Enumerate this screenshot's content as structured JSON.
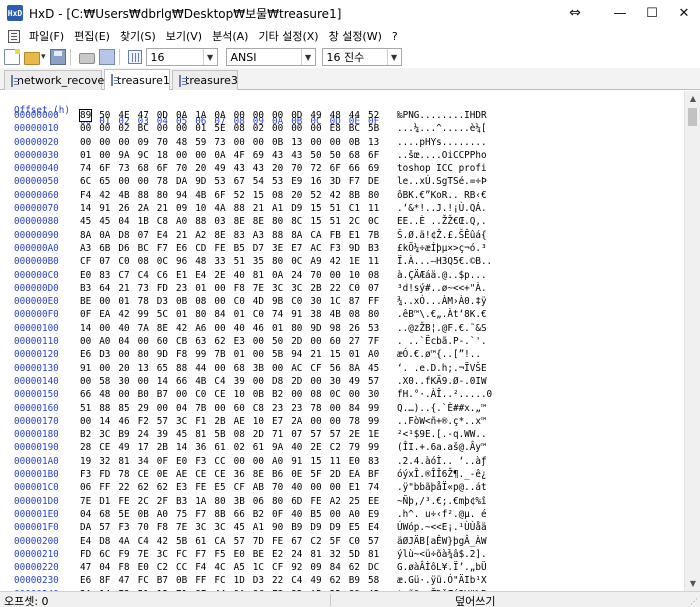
{
  "window": {
    "app_icon_text": "HxD",
    "title": "HxD - [C:₩Users₩dbrlg₩Desktop₩보물₩treasure1]",
    "pin_glyph": "⇔",
    "minimize_glyph": "—",
    "maximize_glyph": "☐",
    "close_glyph": "✕"
  },
  "menu": {
    "items": [
      "파일(F)",
      "편집(E)",
      "찾기(S)",
      "보기(V)",
      "분석(A)",
      "기타 설정(X)",
      "창 설정(W)",
      "?"
    ]
  },
  "toolbar": {
    "bytes_per_row": "16",
    "charset": "ANSI",
    "offset_base": "16 진수"
  },
  "tabs": [
    "network_recover",
    "treasure1",
    "treasure3"
  ],
  "active_tab": "treasure1",
  "editor": {
    "offset_header": "Offset (h)",
    "column_headers": [
      "00",
      "01",
      "02",
      "03",
      "04",
      "05",
      "06",
      "07",
      "08",
      "09",
      "0A",
      "0B",
      "0C",
      "0D",
      "0E",
      "0F"
    ],
    "rows": [
      {
        "offset": "00000000",
        "bytes": [
          "89",
          "50",
          "4E",
          "47",
          "0D",
          "0A",
          "1A",
          "0A",
          "00",
          "00",
          "00",
          "0D",
          "49",
          "48",
          "44",
          "52"
        ],
        "text": "‰PNG........IHDR"
      },
      {
        "offset": "00000010",
        "bytes": [
          "00",
          "00",
          "02",
          "BC",
          "00",
          "00",
          "01",
          "5E",
          "08",
          "02",
          "00",
          "00",
          "00",
          "E8",
          "BC",
          "5B"
        ],
        "text": "...¼...^.....è¼["
      },
      {
        "offset": "00000020",
        "bytes": [
          "00",
          "00",
          "00",
          "09",
          "70",
          "48",
          "59",
          "73",
          "00",
          "00",
          "0B",
          "13",
          "00",
          "00",
          "0B",
          "13"
        ],
        "text": "....pHYs........"
      },
      {
        "offset": "00000030",
        "bytes": [
          "01",
          "00",
          "9A",
          "9C",
          "18",
          "00",
          "00",
          "0A",
          "4F",
          "69",
          "43",
          "43",
          "50",
          "50",
          "68",
          "6F"
        ],
        "text": "..šœ....OiCCPPho"
      },
      {
        "offset": "00000040",
        "bytes": [
          "74",
          "6F",
          "73",
          "68",
          "6F",
          "70",
          "20",
          "49",
          "43",
          "43",
          "20",
          "70",
          "72",
          "6F",
          "66",
          "69"
        ],
        "text": "toshop ICC profi"
      },
      {
        "offset": "00000050",
        "bytes": [
          "6C",
          "65",
          "00",
          "00",
          "78",
          "DA",
          "9D",
          "53",
          "67",
          "54",
          "53",
          "E9",
          "16",
          "3D",
          "F7",
          "DE"
        ],
        "text": "le..xÚ.SgTSé.=÷Þ"
      },
      {
        "offset": "00000060",
        "bytes": [
          "F4",
          "42",
          "4B",
          "88",
          "80",
          "94",
          "4B",
          "6F",
          "52",
          "15",
          "08",
          "20",
          "52",
          "42",
          "8B",
          "80"
        ],
        "text": "ôBK.€”KoR.. RB‹€"
      },
      {
        "offset": "00000070",
        "bytes": [
          "14",
          "91",
          "26",
          "2A",
          "21",
          "09",
          "10",
          "4A",
          "88",
          "21",
          "A1",
          "D9",
          "15",
          "51",
          "C1",
          "11"
        ],
        "text": ".‘&*!..J.!¡Ù.QÁ."
      },
      {
        "offset": "00000080",
        "bytes": [
          "45",
          "45",
          "04",
          "1B",
          "C8",
          "A0",
          "88",
          "03",
          "8E",
          "8E",
          "80",
          "8C",
          "15",
          "51",
          "2C",
          "0C"
        ],
        "text": "EE..È ..ŽŽ€Œ.Q,."
      },
      {
        "offset": "00000090",
        "bytes": [
          "8A",
          "0A",
          "D8",
          "07",
          "E4",
          "21",
          "A2",
          "8E",
          "83",
          "A3",
          "88",
          "8A",
          "CA",
          "FB",
          "E1",
          "7B"
        ],
        "text": "Š.Ø.ä!¢Ž.£.ŠÊûá{"
      },
      {
        "offset": "000000A0",
        "bytes": [
          "A3",
          "6B",
          "D6",
          "BC",
          "F7",
          "E6",
          "CD",
          "FE",
          "B5",
          "D7",
          "3E",
          "E7",
          "AC",
          "F3",
          "9D",
          "B3"
        ],
        "text": "£kÖ¼÷æÍþµ×>ç¬ó.³"
      },
      {
        "offset": "000000B0",
        "bytes": [
          "CF",
          "07",
          "C0",
          "08",
          "0C",
          "96",
          "48",
          "33",
          "51",
          "35",
          "80",
          "0C",
          "A9",
          "42",
          "1E",
          "11"
        ],
        "text": "Ï.À...–H3Q5€.©B.."
      },
      {
        "offset": "000000C0",
        "bytes": [
          "E0",
          "83",
          "C7",
          "C4",
          "C6",
          "E1",
          "E4",
          "2E",
          "40",
          "81",
          "0A",
          "24",
          "70",
          "00",
          "10",
          "08"
        ],
        "text": "à.ÇÄÆáä.@..$p..."
      },
      {
        "offset": "000000D0",
        "bytes": [
          "B3",
          "64",
          "21",
          "73",
          "FD",
          "23",
          "01",
          "00",
          "F8",
          "7E",
          "3C",
          "3C",
          "2B",
          "22",
          "C0",
          "07"
        ],
        "text": "³d!sý#..ø~<<+\"À."
      },
      {
        "offset": "000000E0",
        "bytes": [
          "BE",
          "00",
          "01",
          "78",
          "D3",
          "0B",
          "08",
          "00",
          "C0",
          "4D",
          "9B",
          "C0",
          "30",
          "1C",
          "87",
          "FF"
        ],
        "text": "¾..xÓ...ÀM›À0.‡ÿ"
      },
      {
        "offset": "000000F0",
        "bytes": [
          "0F",
          "EA",
          "42",
          "99",
          "5C",
          "01",
          "80",
          "84",
          "01",
          "C0",
          "74",
          "91",
          "38",
          "4B",
          "08",
          "80"
        ],
        "text": ".êB™\\.€„.Àt‘8K.€"
      },
      {
        "offset": "00000100",
        "bytes": [
          "14",
          "00",
          "40",
          "7A",
          "8E",
          "42",
          "A6",
          "00",
          "40",
          "46",
          "01",
          "80",
          "9D",
          "98",
          "26",
          "53"
        ],
        "text": "..@zŽB¦.@F.€.˜&S"
      },
      {
        "offset": "00000110",
        "bytes": [
          "00",
          "A0",
          "04",
          "00",
          "60",
          "CB",
          "63",
          "62",
          "E3",
          "00",
          "50",
          "2D",
          "00",
          "60",
          "27",
          "7F"
        ],
        "text": ". ..`Ëcbã.P-.`'."
      },
      {
        "offset": "00000120",
        "bytes": [
          "E6",
          "D3",
          "00",
          "80",
          "9D",
          "F8",
          "99",
          "7B",
          "01",
          "00",
          "5B",
          "94",
          "21",
          "15",
          "01",
          "A0"
        ],
        "text": "æÓ.€.ø™{..[”!.. "
      },
      {
        "offset": "00000130",
        "bytes": [
          "91",
          "00",
          "20",
          "13",
          "65",
          "88",
          "44",
          "00",
          "68",
          "3B",
          "00",
          "AC",
          "CF",
          "56",
          "8A",
          "45"
        ],
        "text": "‘. .e.D.h;.¬ÏVŠE"
      },
      {
        "offset": "00000140",
        "bytes": [
          "00",
          "58",
          "30",
          "00",
          "14",
          "66",
          "4B",
          "C4",
          "39",
          "00",
          "D8",
          "2D",
          "00",
          "30",
          "49",
          "57"
        ],
        "text": ".X0..fKÄ9.Ø-.0IW"
      },
      {
        "offset": "00000150",
        "bytes": [
          "66",
          "48",
          "00",
          "B0",
          "B7",
          "00",
          "C0",
          "CE",
          "10",
          "0B",
          "B2",
          "00",
          "08",
          "0C",
          "00",
          "30"
        ],
        "text": "fH.°·.ÀÎ..².....0"
      },
      {
        "offset": "00000160",
        "bytes": [
          "51",
          "88",
          "85",
          "29",
          "00",
          "04",
          "7B",
          "00",
          "60",
          "C8",
          "23",
          "23",
          "78",
          "00",
          "84",
          "99"
        ],
        "text": "Q.…)..{.`È##x.„™"
      },
      {
        "offset": "00000170",
        "bytes": [
          "00",
          "14",
          "46",
          "F2",
          "57",
          "3C",
          "F1",
          "2B",
          "AE",
          "10",
          "E7",
          "2A",
          "00",
          "00",
          "78",
          "99"
        ],
        "text": "..FòW<ñ+®.ç*..x™"
      },
      {
        "offset": "00000180",
        "bytes": [
          "B2",
          "3C",
          "B9",
          "24",
          "39",
          "45",
          "81",
          "5B",
          "08",
          "2D",
          "71",
          "07",
          "57",
          "57",
          "2E",
          "1E"
        ],
        "text": "²<¹$9E.[.-q.WW.."
      },
      {
        "offset": "00000190",
        "bytes": [
          "28",
          "CE",
          "49",
          "17",
          "2B",
          "14",
          "36",
          "61",
          "02",
          "61",
          "9A",
          "40",
          "2E",
          "C2",
          "79",
          "99"
        ],
        "text": "(ÎI.+.6a.aš@.Ây™"
      },
      {
        "offset": "000001A0",
        "bytes": [
          "19",
          "32",
          "81",
          "34",
          "0F",
          "E0",
          "F3",
          "CC",
          "00",
          "00",
          "A0",
          "91",
          "15",
          "11",
          "E0",
          "83"
        ],
        "text": ".2.4.àóÌ.. ‘..àƒ"
      },
      {
        "offset": "000001B0",
        "bytes": [
          "F3",
          "FD",
          "78",
          "CE",
          "0E",
          "AE",
          "CE",
          "CE",
          "36",
          "8E",
          "B6",
          "0E",
          "5F",
          "2D",
          "EA",
          "BF"
        ],
        "text": "óýxÎ.®ÎÎ6Ž¶._-ê¿"
      },
      {
        "offset": "000001C0",
        "bytes": [
          "06",
          "FF",
          "22",
          "62",
          "62",
          "E3",
          "FE",
          "E5",
          "CF",
          "AB",
          "70",
          "40",
          "00",
          "00",
          "E1",
          "74"
        ],
        "text": ".ÿ\"bbãþåÏ«p@..át"
      },
      {
        "offset": "000001D0",
        "bytes": [
          "7E",
          "D1",
          "FE",
          "2C",
          "2F",
          "B3",
          "1A",
          "80",
          "3B",
          "06",
          "80",
          "6D",
          "FE",
          "A2",
          "25",
          "EE"
        ],
        "text": "~Ñþ,/³.€;.€mþ¢%î"
      },
      {
        "offset": "000001E0",
        "bytes": [
          "04",
          "68",
          "5E",
          "0B",
          "A0",
          "75",
          "F7",
          "8B",
          "66",
          "B2",
          "0F",
          "40",
          "B5",
          "00",
          "A0",
          "E9"
        ],
        "text": ".h^. u÷‹f².@µ. é"
      },
      {
        "offset": "000001F0",
        "bytes": [
          "DA",
          "57",
          "F3",
          "70",
          "F8",
          "7E",
          "3C",
          "3C",
          "45",
          "A1",
          "90",
          "B9",
          "D9",
          "D9",
          "E5",
          "E4"
        ],
        "text": "ÚWóp.~<<E¡.¹ÙÙåä"
      },
      {
        "offset": "00000200",
        "bytes": [
          "E4",
          "D8",
          "4A",
          "C4",
          "42",
          "5B",
          "61",
          "CA",
          "57",
          "7D",
          "FE",
          "67",
          "C2",
          "5F",
          "C0",
          "57"
        ],
        "text": "äØJÄB[aÊW}þgÂ_ÀW"
      },
      {
        "offset": "00000210",
        "bytes": [
          "FD",
          "6C",
          "F9",
          "7E",
          "3C",
          "FC",
          "F7",
          "F5",
          "E0",
          "BE",
          "E2",
          "24",
          "81",
          "32",
          "5D",
          "81"
        ],
        "text": "ýlù~<ü÷õà¾â$.2]."
      },
      {
        "offset": "00000220",
        "bytes": [
          "47",
          "04",
          "F8",
          "E0",
          "C2",
          "CC",
          "F4",
          "4C",
          "A5",
          "1C",
          "CF",
          "92",
          "09",
          "84",
          "62",
          "DC"
        ],
        "text": "G.øàÂÌôL¥.Ï’.„bÜ"
      },
      {
        "offset": "00000230",
        "bytes": [
          "E6",
          "8F",
          "47",
          "FC",
          "B7",
          "0B",
          "FF",
          "FC",
          "1D",
          "D3",
          "22",
          "C4",
          "49",
          "62",
          "B9",
          "58"
        ],
        "text": "æ.Gü·.ÿü.Ó\"ÄIb¹X"
      },
      {
        "offset": "00000240",
        "bytes": [
          "2A",
          "14",
          "E3",
          "51",
          "12",
          "71",
          "8E",
          "44",
          "9A",
          "8C",
          "F3",
          "32",
          "A5",
          "22",
          "89",
          "42"
        ],
        "text": "*.ãQ.qŽDšŒó2¥\"‰B"
      }
    ]
  },
  "statusbar": {
    "offset_label": "오프셋: 0",
    "mode_label": "덮어쓰기"
  },
  "scrollbar": {
    "up_glyph": "▲",
    "down_glyph": "▼"
  }
}
